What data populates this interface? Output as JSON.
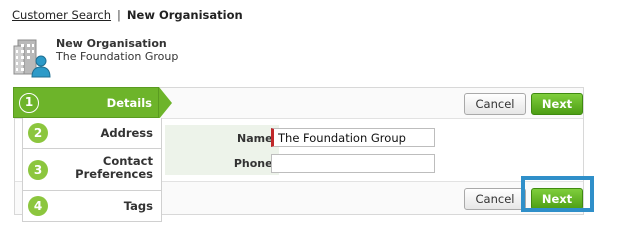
{
  "breadcrumb": {
    "link": "Customer Search",
    "separator": "|",
    "current": "New Organisation"
  },
  "entity": {
    "icon": "organisation-building-person-icon",
    "title": "New Organisation",
    "subtitle": "The Foundation Group"
  },
  "steps": [
    {
      "number": "1",
      "label": "Details",
      "active": true
    },
    {
      "number": "2",
      "label": "Address",
      "active": false
    },
    {
      "number": "3",
      "label": "Contact Preferences",
      "active": false
    },
    {
      "number": "4",
      "label": "Tags",
      "active": false
    }
  ],
  "form": {
    "name_label": "Name:",
    "name_value": "The Foundation Group",
    "phone_label": "Phone:",
    "phone_value": ""
  },
  "buttons": {
    "cancel": "Cancel",
    "next": "Next"
  },
  "colors": {
    "accent_green": "#6db42a",
    "required_marker": "#c0282a",
    "highlight_blue": "#2f8fc9"
  }
}
